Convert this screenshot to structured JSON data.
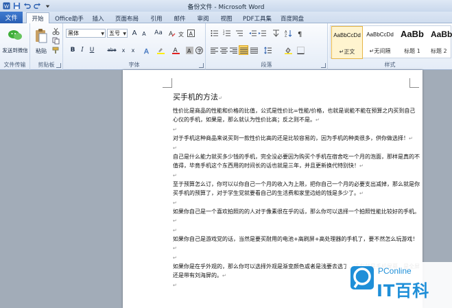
{
  "window": {
    "title": "备份文件 - Microsoft Word"
  },
  "tabs": {
    "file": "文件",
    "items": [
      "开始",
      "Office助手",
      "插入",
      "页面布局",
      "引用",
      "邮件",
      "审阅",
      "视图",
      "PDF工具集",
      "百度网盘"
    ]
  },
  "ribbon": {
    "groups": {
      "file_transfer": "文件传输",
      "clipboard": "剪贴板",
      "font": "字体",
      "paragraph": "段落",
      "styles": "样式"
    },
    "send_to_wechat": "发送到微信",
    "paste": "粘贴",
    "font_name": "黑体",
    "font_size": "五号",
    "font_size_increase": "A",
    "font_size_decrease": "A",
    "change_case": "Aa",
    "bold": "B",
    "italic": "I",
    "underline": "U",
    "strikethrough": "abe",
    "subscript": "x",
    "superscript": "x",
    "styles": [
      {
        "preview": "AaBbCcDd",
        "name": "↵正文",
        "selected": true
      },
      {
        "preview": "AaBbCcDd",
        "name": "↵无间隔",
        "selected": false
      },
      {
        "preview": "AaBb",
        "name": "标题 1",
        "selected": false
      },
      {
        "preview": "AaBb",
        "name": "标题 2",
        "selected": false
      }
    ]
  },
  "document": {
    "title": "买手机的方法",
    "paragraphs": [
      "性价比是商品的性能和价格的比值，公式是性价比=性能/价格，也就是说能不能在预算之内买到自己心仪的手机，如果是，那么就认为性价比高；反之则不是。",
      "",
      "对于手机这种商品来说买到一款性价比高的还是比较容易的，因为手机的种类很多，供你做选择！",
      "",
      "自己是什么能力就买多少钱的手机，完全没必要因为购买个手机在宿舍吃一个月的泡面，那样是真的不值得，毕竟手机这个东西用的时间长的话也就是三年，并且更新换代特别快！",
      "",
      "至于预算怎么订，你可以以你自己一个月的收入为上限，把你自己一个月的必要支出减掉，那么就是你买手机的预算了，对于学生党就要看自己的生活费和家里边给的钱是多少了。",
      "",
      "如果你自己是一个喜欢拍照的的人对于像素很在乎的话，那么你可以选择一个拍照性能比较好的手机。",
      "",
      "如果你自己是游戏党的话，当然是要买耐用的电池+高刷屏+高处理器的手机了，要不然怎么玩游戏！",
      "",
      "如果你是在乎外观的，那么你可以选择外观是渐变颜色或者是浅要去选了，还有就是手机屏幕，是全屏还是带有刘海屏的。",
      ""
    ],
    "paragraph_mark": "↵"
  },
  "watermark": {
    "brand": "PConline",
    "logo_text": "IT百科"
  },
  "colors": {
    "file_tab": "#2a5fb4",
    "ribbon_bg": "#e4ecf7",
    "selected_style": "#fff4cf",
    "watermark_blue": "#1f8fd8"
  }
}
